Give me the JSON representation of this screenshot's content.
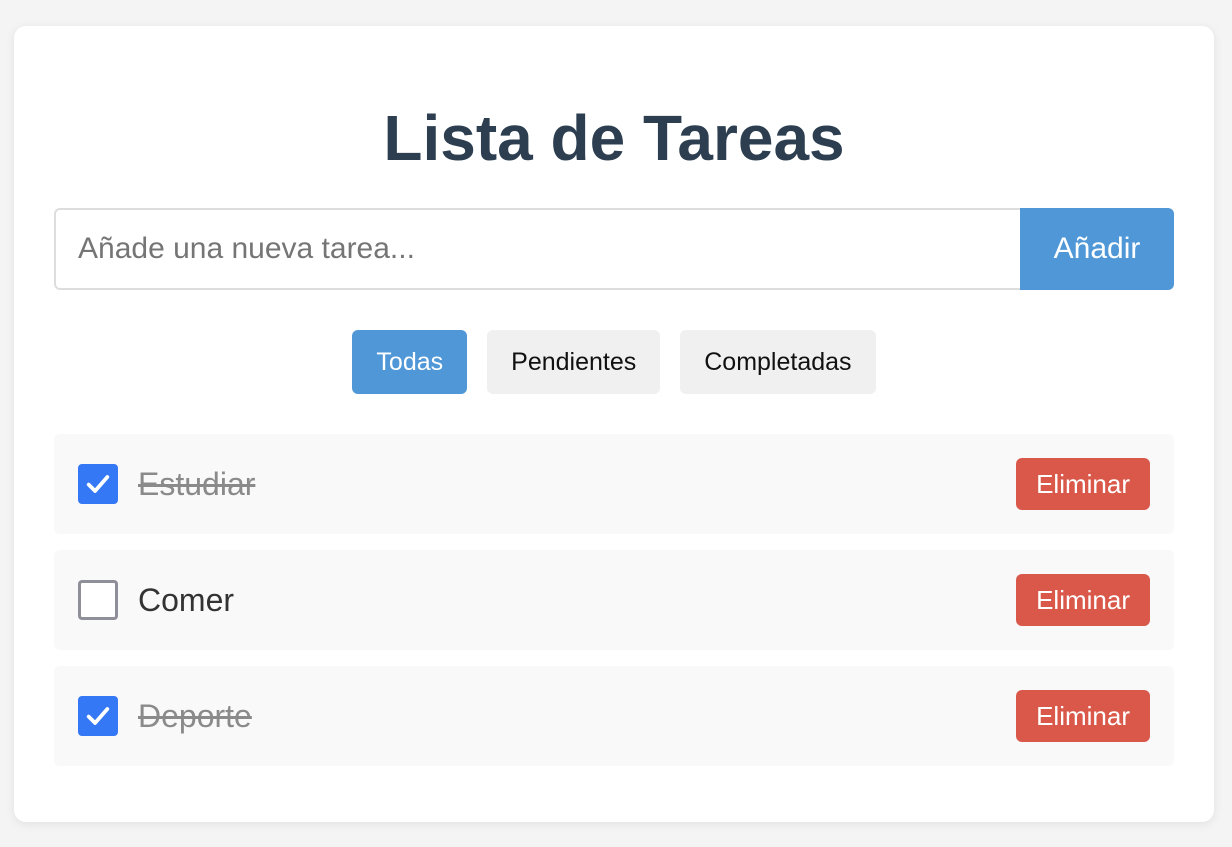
{
  "app": {
    "title": "Lista de Tareas"
  },
  "add_form": {
    "placeholder": "Añade una nueva tarea...",
    "value": "",
    "button_label": "Añadir"
  },
  "filters": [
    {
      "label": "Todas",
      "active": true
    },
    {
      "label": "Pendientes",
      "active": false
    },
    {
      "label": "Completadas",
      "active": false
    }
  ],
  "tasks": [
    {
      "label": "Estudiar",
      "completed": true,
      "delete_label": "Eliminar"
    },
    {
      "label": "Comer",
      "completed": false,
      "delete_label": "Eliminar"
    },
    {
      "label": "Deporte",
      "completed": true,
      "delete_label": "Eliminar"
    }
  ],
  "colors": {
    "accent": "#4f97d7",
    "title": "#2c3e50",
    "delete": "#d9584a",
    "checkbox_checked": "#3478f6"
  },
  "icons": {
    "checked": "check-icon"
  }
}
